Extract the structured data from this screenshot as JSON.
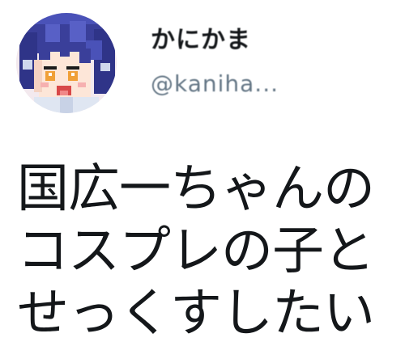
{
  "tweet": {
    "author": {
      "display_name": "かにかま",
      "handle": "@kaniha...",
      "avatar": "anime-character-avatar"
    },
    "text": "国広一ちゃんの\nコスプレの子と\nせっくすしたい"
  }
}
